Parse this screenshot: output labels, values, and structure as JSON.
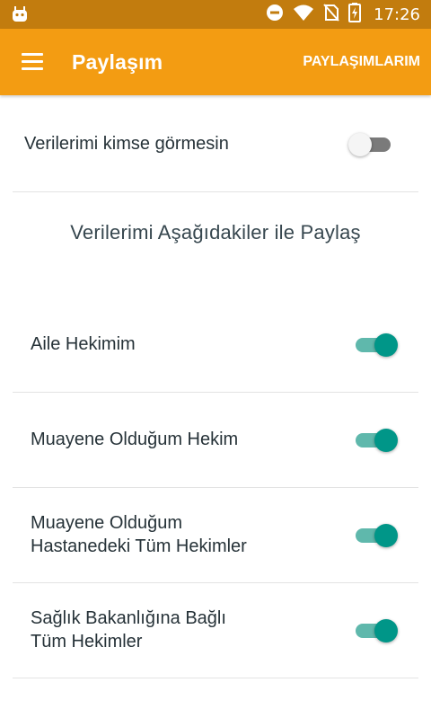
{
  "status_bar": {
    "time": "17:26",
    "icons": [
      "android-icon",
      "do-not-disturb-icon",
      "wifi-icon",
      "no-sim-icon",
      "battery-charging-icon"
    ]
  },
  "app_bar": {
    "menu_icon": "hamburger-menu-icon",
    "title": "Paylaşım",
    "action_label": "PAYLAŞIMLARIM"
  },
  "privacy": {
    "label": "Verilerimi kimse görmesin",
    "enabled": false
  },
  "share_section": {
    "heading": "Verilerimi Aşağıdakiler ile Paylaş",
    "items": [
      {
        "lines": [
          "Aile Hekimim"
        ],
        "enabled": true
      },
      {
        "lines": [
          "Muayene Olduğum Hekim"
        ],
        "enabled": true
      },
      {
        "lines": [
          "Muayene Olduğum",
          "Hastanedeki Tüm Hekimler"
        ],
        "enabled": true
      },
      {
        "lines": [
          "Sağlık Bakanlığına Bağlı",
          "Tüm Hekimler"
        ],
        "enabled": true
      }
    ]
  },
  "colors": {
    "status_bar": "#c27c0e",
    "app_bar": "#f39c12",
    "switch_on_thumb": "#009688",
    "switch_on_track": "#5fb8ac",
    "switch_off_track": "#7a7a7a",
    "text": "#263238"
  }
}
